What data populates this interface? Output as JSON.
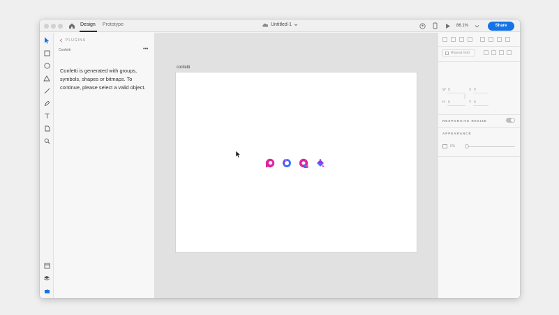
{
  "titlebar": {
    "tabs": [
      "Design",
      "Prototype"
    ],
    "document_title": "Untitled-1",
    "zoom": "86.1%",
    "share_label": "Share"
  },
  "toolbar": {
    "tools": [
      "select-tool-icon",
      "rectangle-tool-icon",
      "ellipse-tool-icon",
      "triangle-tool-icon",
      "line-tool-icon",
      "pen-tool-icon",
      "text-tool-icon",
      "artboard-tool-icon",
      "zoom-tool-icon"
    ],
    "bottom_tools": [
      "assets-icon",
      "layers-icon",
      "plugins-icon"
    ]
  },
  "plugins_panel": {
    "header": "PLUGINS",
    "plugin_name": "Confetti",
    "more": "•••",
    "message": "Confetti is generated with groups, symbols, shapes or bitmaps. To continue, please select a valid object."
  },
  "canvas": {
    "artboard_name": "confetti",
    "confetti_colors": {
      "magenta": "#e0249d",
      "pink": "#ff3fa0",
      "blue": "#3d6fff",
      "purple": "#7c3df2"
    }
  },
  "properties": {
    "repeat_grid": "Repeat Grid",
    "w_label": "W",
    "w_value": "0",
    "x_label": "X",
    "x_value": "0",
    "h_label": "H",
    "h_value": "0",
    "y_label": "Y",
    "y_value": "0",
    "responsive_resize": "RESPONSIVE RESIZE",
    "appearance": "APPEARANCE",
    "opacity": "0%"
  },
  "colors": {
    "accent": "#1473e6",
    "toolbar_active": "#1473e6"
  }
}
